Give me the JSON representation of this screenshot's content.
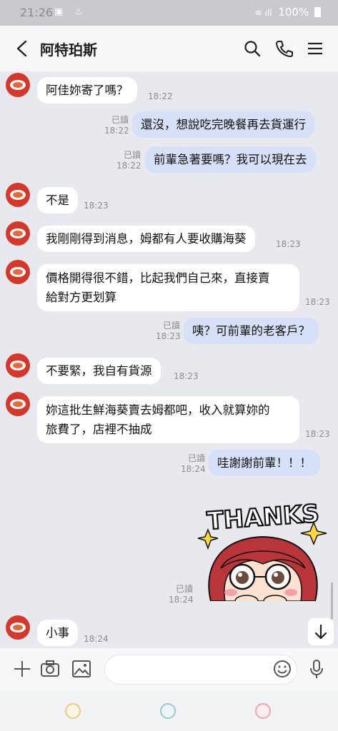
{
  "status_bar": {
    "time": "21:26",
    "battery": "100%"
  },
  "header": {
    "title": "阿特珀斯"
  },
  "messages": [
    {
      "text": "阿佳妳寄了嗎？",
      "time": "18:22"
    },
    {
      "text": "還沒，想說吃完晚餐再去貨運行",
      "read": "已讀",
      "time": "18:22"
    },
    {
      "text": "前輩急著要嗎？我可以現在去",
      "read": "已讀",
      "time": "18:22"
    },
    {
      "text": "不是",
      "time": "18:23"
    },
    {
      "text": "我剛剛得到消息，姆都有人要收購海葵",
      "time": "18:23"
    },
    {
      "line1": "價格開得很不錯，比起我們自己來，直接賣",
      "line2": "給對方更划算",
      "time": "18:23"
    },
    {
      "text": "咦？可前輩的老客戶？",
      "read": "已讀",
      "time": "18:23"
    },
    {
      "text": "不要緊，我自有貨源",
      "time": "18:23"
    },
    {
      "line1": "妳這批生鮮海葵賣去姆都吧，收入就算妳的",
      "line2": "旅費了，店裡不抽成",
      "time": "18:23"
    },
    {
      "text": "哇謝謝前輩！！！",
      "read": "已讀",
      "time": "18:24"
    },
    {
      "sticker_text": "THANKS",
      "read": "已讀",
      "time": "18:24"
    },
    {
      "text": "小事",
      "time": "18:24"
    }
  ],
  "colors": {
    "my_bubble": "#d6e1f7",
    "their_bubble": "#ffffff",
    "background": "#e8e9ee"
  },
  "icons": [
    "back-arrow-icon",
    "search-icon",
    "phone-icon",
    "menu-icon",
    "plus-icon",
    "camera-icon",
    "image-icon",
    "emoji-icon",
    "mic-icon",
    "arrow-down-icon"
  ]
}
